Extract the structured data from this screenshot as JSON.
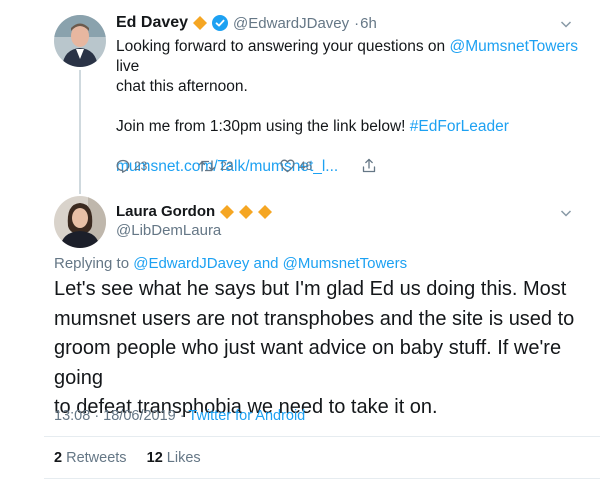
{
  "parent_tweet": {
    "name": "Ed Davey",
    "handle": "@EdwardJDavey",
    "time": "6h",
    "line1_prefix": "Looking forward to answering your questions on ",
    "line1_mention": "@MumsnetTowers",
    "line1_suffix": " live",
    "line2": "chat this afternoon.",
    "line3_prefix": "Join me from 1:30pm using the link below! ",
    "line3_hashtag": "#EdForLeader",
    "link": "mumsnet.com/Talk/mumsnet_l...",
    "replies": "23",
    "retweets": "23",
    "likes": "46"
  },
  "main_tweet": {
    "name": "Laura Gordon",
    "handle": "@LibDemLaura",
    "replying_prefix": "Replying to ",
    "replying_to": "@EdwardJDavey and @MumsnetTowers",
    "text_lines": [
      "Let's see what he says but I'm glad Ed us doing this. Most",
      "mumsnet users are not transphobes and the site is used to",
      "groom people who just want advice on baby stuff. If we're going",
      "to defeat transphobia we need to take it on."
    ],
    "timestamp": "13:08 · 18/06/2019",
    "source": "Twitter for Android",
    "retweet_count": "2",
    "retweet_label": "Retweets",
    "like_count": "12",
    "like_label": "Likes"
  },
  "colors": {
    "accent": "#1da1f2",
    "badge_orange": "#f5a623",
    "verified": "#1da1f2",
    "secondary_text": "#657786"
  }
}
